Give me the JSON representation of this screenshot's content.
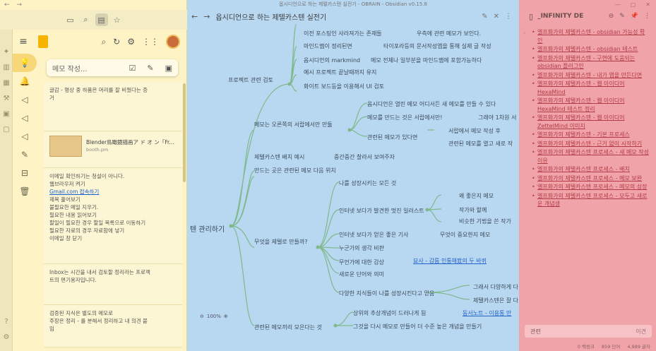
{
  "keep": {
    "nav_arrows": [
      "←",
      "→"
    ],
    "compose_placeholder": "메모 작성...",
    "notes": [
      {
        "lines": [
          "글감 - 명상 중 하품은 머리를 잘 비웠다는 증",
          "거"
        ]
      },
      {
        "bookmark": {
          "title": "Blender鳥瞰鏡描画ア ド オ ン「Fr...",
          "domain": "booth.pm"
        }
      },
      {
        "lines": [
          "이메일 확인하기는 청설이 아니다.",
          "웹브라우저 켜기",
          "Gmail.com 접속하기",
          "제목 훑어보기",
          "불필요한 메일 지우기.",
          "필요한 내용 읽어보기",
          "할일이 필요한 경우 할일 목록으로 이동하기",
          "필요한 자료의 경우 자료함에 넣기",
          "이메일 창 닫기"
        ],
        "link_index": 2
      },
      {
        "lines": [
          "Inbox는 시간을 내서 검토할 정리라는 프로젝",
          "트의 편기용자입니다."
        ]
      },
      {
        "lines": [
          "검증된 지식은 별도의 메모로",
          "주장은 정리 - 를 분해서 정리하고 내 의견 붙",
          "임"
        ]
      }
    ]
  },
  "obsidian": {
    "window_title": "옵시디언으로 하는 제텔카스텐 실전기 - OBRAIN - Obsidian v0.15.8",
    "tab_title": "옵시디언으로 하는 제텔카스텐 실전기",
    "root": "텐 관리하기",
    "zoom": "100%",
    "nodes": [
      "이전 포스팅인 사라져가는 존재들",
      "우측에 관련 메모가 보인다.",
      "마인드맵이 정리된면",
      "타이포라등의 문서작성앱을 통해 실제 글 작성",
      "옵시디언의 markmind",
      "메모 전체나 일부분을 마인드맵에 포함가능하다",
      "프로젝트 관련 검토",
      "예시 프로젝트 끝날때까지 유지",
      "화이트 보드등을 이용해서 UI 검토",
      "옵시디언은 열린 메모 어디서든 새 메모를 만들 수 있다",
      "메모는 오른쪽의 서랍에서만 만듦",
      "메모를 만드는 것은 서랍에서만!",
      "그래야 1차원 서",
      "관련된 메모가 있다면",
      "서랍에서 메모 작성 후",
      "관련된 메모를 열고 새로 작",
      "제텔카스텐 배치 예시",
      "중간중간 찰라서 보여주자",
      "만드는 곳은 관련된 메모 다음 위치",
      "나를 성장시키는 모든 것",
      "왜 좋은지 메모",
      "인터넷 보다가 발견한 멋진 일러스트",
      "작가와 할께",
      "비슷한 기법을 쓴 작가",
      "인터넷 보다가 얻은 좋은 기사",
      "무엇이 중요한지 메모",
      "무엇을 제텔로 만들까?",
      "누군가의 생각 비판",
      "무언가에 대한 감상",
      "묘사 - 감름 인통해봤의 두 바퀴",
      "새로운 단어와 의미",
      "다양한 지식들이 나를 성장시킨다고 믿음",
      "그래서 다양하게 다",
      "제텔카스텐은 잘 다",
      "상위의 추상개념이 드러나게 됨",
      "동서노트 - 이용통 만",
      "관련된 메모끼리 모은다는 것",
      "그것을 다시 메모로 만들어 더 수준 높은 개념을 만들기"
    ]
  },
  "infinity": {
    "title": "_INFINITY DE",
    "items": [
      "엘프화가의 제텔카스텐 - obsidian 가능성 확인",
      "엘프화가의 제텔카스텐 - obsidian 테스트",
      "엘프화가의 제텔카스텐 - 구현에 도움되는 obsidian 플러그인",
      "엘프화가의 제텔카스텐 - 내가 앱을 만든다면",
      "엘프화가의 제텔카스텐 - 웹 아이디어 HexaMind",
      "엘프화가의 제텔카스텐 - 웹 아이디어 HexaMind 테스트 정리",
      "엘프화가의 제텔카스텐 - 웹 아이디어 ZettelMind 이미지",
      "엘프화가의 제텔카스텐 - 기본 프로세스",
      "엘프화가의 제텔카스텐 - 근거 없이 시작하기",
      "엘프화가의 제텔카스텐 프로세스 - 새 메모 작성 이유",
      "엘프화가의 제텔카스텐 프로세스 - 배치",
      "엘프화가의 제텔카스텐 프로세스 - 메모 보완",
      "엘프화가의 제텔카스텐 프로세스 - 메모의 성장",
      "엘프화가의 제텔카스텐 프로세스 - 모두고 새로운 개념생"
    ],
    "footer_input": "관련",
    "footer_button": "이견",
    "status": [
      "0 백링크",
      "859 단어",
      "4,989 글자"
    ]
  }
}
